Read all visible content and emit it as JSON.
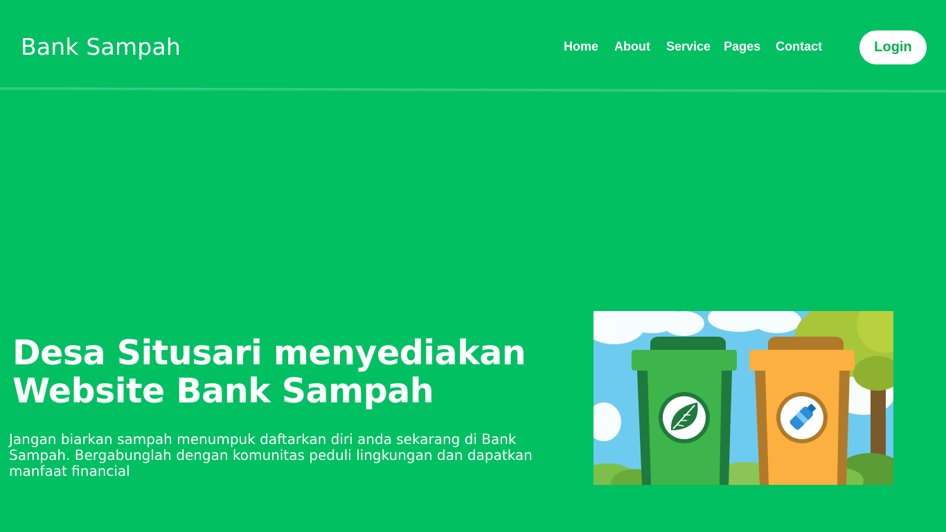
{
  "navbar": {
    "brand": "Bank Sampah",
    "links": [
      {
        "label": "Home"
      },
      {
        "label": "About"
      },
      {
        "label": "Service"
      },
      {
        "label": "Pages"
      },
      {
        "label": "Contact"
      }
    ],
    "login_label": "Login"
  },
  "hero": {
    "title_line1": "Desa Situsari menyediakan",
    "title_line2": "Website Bank Sampah",
    "description": "Jangan biarkan sampah menumpuk daftarkan diri anda sekarang di Bank Sampah. Bergabunglah dengan komunitas peduli lingkungan dan dapatkan manfaat financial",
    "image": {
      "icon_left": "leaf-icon",
      "icon_right": "plastic-bottle-icon",
      "colors": {
        "sky": "#6ecbf0",
        "left_bin": "#3db54a",
        "right_bin": "#fbb040"
      }
    }
  },
  "colors": {
    "background": "#00c062",
    "accent": "#ffffff",
    "login_text": "#00b04f"
  }
}
